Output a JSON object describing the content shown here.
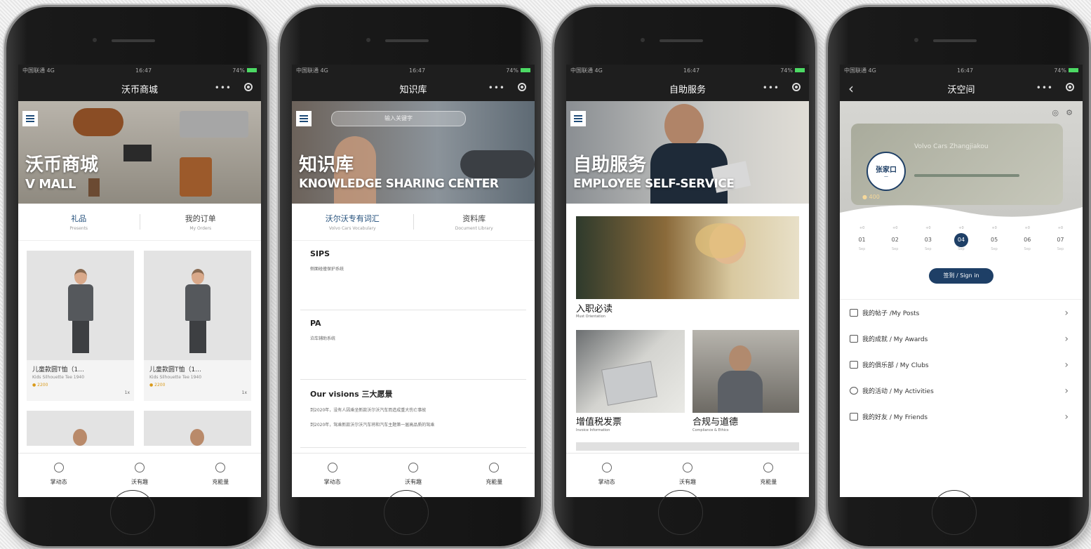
{
  "status": {
    "carrier": "中国联通 4G",
    "time": "16:47",
    "battery": "74%"
  },
  "nav_more": "•••",
  "bottom_nav": [
    {
      "label": "掌动态"
    },
    {
      "label": "沃有趣"
    },
    {
      "label": "充能量"
    }
  ],
  "phone1": {
    "title": "沃币商城",
    "banner_cn": "沃币商城",
    "banner_en": "V MALL",
    "tabs": [
      {
        "cn": "礼品",
        "en": "Presents"
      },
      {
        "cn": "我的订单",
        "en": "My Orders"
      }
    ],
    "products": [
      {
        "name": "儿童款圆T恤（1...",
        "en": "Kids Silhouette Tee 1940",
        "coin": "2200",
        "qty": "1x"
      },
      {
        "name": "儿童款圆T恤（1...",
        "en": "Kids Silhouette Tee 1940",
        "coin": "2200",
        "qty": "1x"
      }
    ]
  },
  "phone2": {
    "title": "知识库",
    "banner_cn": "知识库",
    "banner_en": "KNOWLEDGE SHARING CENTER",
    "search_placeholder": "输入关键字",
    "tabs": [
      {
        "cn": "沃尔沃专有词汇",
        "en": "Volvo Cars Vocabulary"
      },
      {
        "cn": "资料库",
        "en": "Document Library"
      }
    ],
    "entries": [
      {
        "title": "SIPS",
        "desc": "侧面碰撞保护系统"
      },
      {
        "title": "PA",
        "desc": "泊车辅助系统"
      },
      {
        "title": "Our visions 三大愿景",
        "desc": "到2020年，没有人因乘坐新款沃尔沃汽车而造成重大伤亡事故",
        "desc2": "到2020年，驾乘新款沃尔沃汽车将和汽车主题第一届高品质的驾乘"
      }
    ]
  },
  "phone3": {
    "title": "自助服务",
    "banner_cn": "自助服务",
    "banner_en": "EMPLOYEE SELF-SERVICE",
    "tiles": [
      {
        "cn": "入职必读",
        "en": "Must Orientation"
      },
      {
        "cn": "增值税发票",
        "en": "Invoice Information"
      },
      {
        "cn": "合规与道德",
        "en": "Compliance & Ethics"
      }
    ]
  },
  "phone4": {
    "title": "沃空间",
    "back": "‹",
    "card": {
      "logo": "张家口",
      "company": "Volvo Cars Zhangjiakou",
      "coins": "400"
    },
    "days": [
      {
        "d": "01",
        "s": "+0",
        "t": "Sep"
      },
      {
        "d": "02",
        "s": "+0",
        "t": "Sep"
      },
      {
        "d": "03",
        "s": "+0",
        "t": "Sep"
      },
      {
        "d": "04",
        "s": "+0",
        "t": "Sep"
      },
      {
        "d": "05",
        "s": "+0",
        "t": "Sep"
      },
      {
        "d": "06",
        "s": "+0",
        "t": "Sep"
      },
      {
        "d": "07",
        "s": "+0",
        "t": "Sep"
      }
    ],
    "signin": "签到 / Sign in",
    "menu": [
      {
        "label": "我的帖子 /My Posts"
      },
      {
        "label": "我的成就 / My Awards"
      },
      {
        "label": "我的俱乐部 / My Clubs"
      },
      {
        "label": "我的活动 / My Activities"
      },
      {
        "label": "我的好友 / My Friends"
      }
    ]
  }
}
